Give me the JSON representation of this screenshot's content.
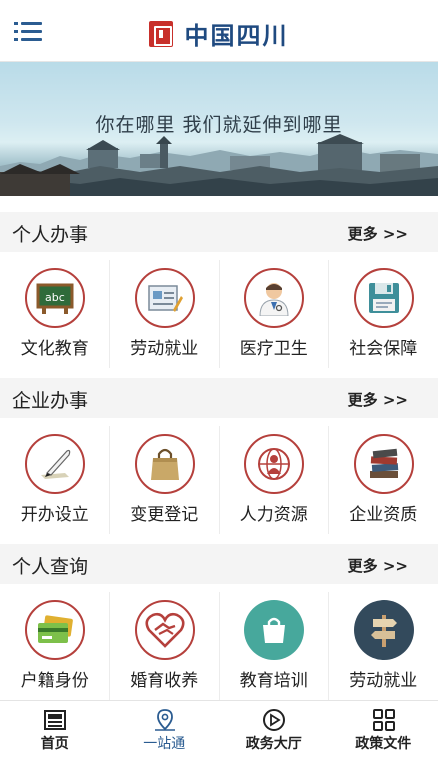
{
  "header": {
    "title": "中国四川",
    "menu_icon": "menu-icon",
    "logo_icon": "seal-logo-icon",
    "brand_color": "#1f4a80",
    "seal_color": "#c8302b"
  },
  "banner": {
    "slogan": "你在哪里 我们就延伸到哪里"
  },
  "sections": [
    {
      "title": "个人办事",
      "more_label": "更多 >>",
      "items": [
        {
          "label": "文化教育",
          "icon": "chalkboard-icon"
        },
        {
          "label": "劳动就业",
          "icon": "document-pen-icon"
        },
        {
          "label": "医疗卫生",
          "icon": "doctor-icon"
        },
        {
          "label": "社会保障",
          "icon": "floppy-disk-icon"
        }
      ]
    },
    {
      "title": "企业办事",
      "more_label": "更多 >>",
      "items": [
        {
          "label": "开办设立",
          "icon": "quill-pen-icon"
        },
        {
          "label": "变更登记",
          "icon": "shopping-bag-icon"
        },
        {
          "label": "人力资源",
          "icon": "people-globe-icon"
        },
        {
          "label": "企业资质",
          "icon": "books-stack-icon"
        }
      ]
    },
    {
      "title": "个人查询",
      "more_label": "更多 >>",
      "items": [
        {
          "label": "户籍身份",
          "icon": "id-cards-icon"
        },
        {
          "label": "婚育收养",
          "icon": "heart-handshake-icon"
        },
        {
          "label": "教育培训",
          "icon": "bag-icon"
        },
        {
          "label": "劳动就业",
          "icon": "signpost-icon"
        }
      ]
    }
  ],
  "bottom_nav": [
    {
      "label": "首页",
      "icon": "newspaper-icon",
      "active": false
    },
    {
      "label": "一站通",
      "icon": "location-pin-icon",
      "active": true
    },
    {
      "label": "政务大厅",
      "icon": "play-circle-icon",
      "active": false
    },
    {
      "label": "政策文件",
      "icon": "grid-icon",
      "active": false
    }
  ],
  "colors": {
    "accent_red": "#b5403c",
    "nav_active": "#2b5c91",
    "teal": "#47a89c",
    "dark_slate": "#334a5c"
  }
}
